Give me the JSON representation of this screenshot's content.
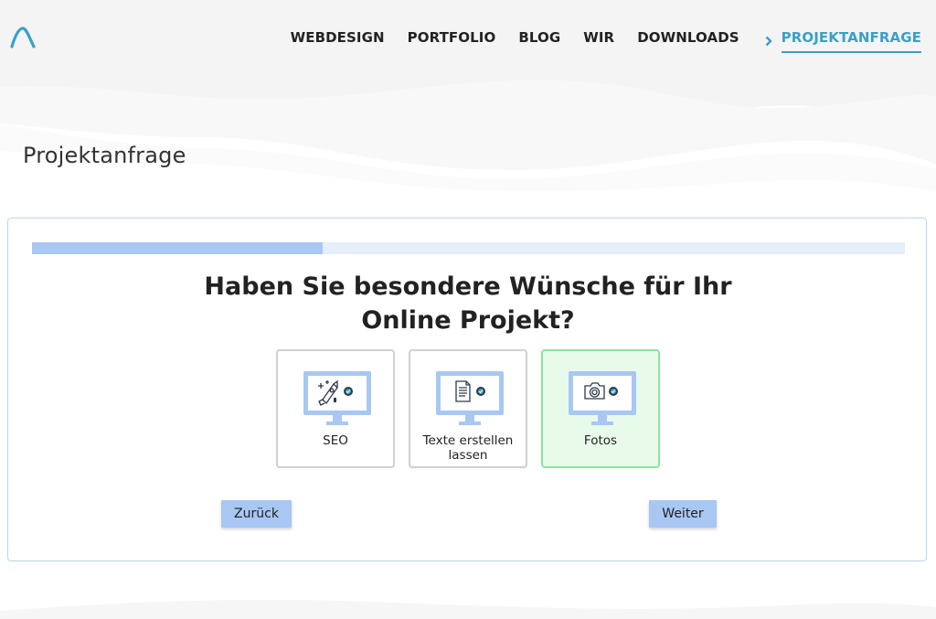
{
  "nav": {
    "items": [
      {
        "label": "WEBDESIGN"
      },
      {
        "label": "PORTFOLIO"
      },
      {
        "label": "BLOG"
      },
      {
        "label": "WIR"
      },
      {
        "label": "DOWNLOADS"
      }
    ],
    "active": {
      "label": "PROJEKTANFRAGE",
      "icon": "chevron-right-icon"
    }
  },
  "page": {
    "title": "Projektanfrage"
  },
  "wizard": {
    "progress": 0.333,
    "question_line1": "Haben Sie besondere Wünsche für Ihr",
    "question_line2": "Online Projekt?",
    "options": [
      {
        "label": "SEO",
        "icon": "seo-rocket-icon",
        "selected": false
      },
      {
        "label": "Texte erstellen lassen",
        "icon": "document-icon",
        "selected": false
      },
      {
        "label": "Fotos",
        "icon": "camera-icon",
        "selected": true
      }
    ],
    "back_label": "Zurück",
    "next_label": "Weiter"
  },
  "colors": {
    "accent": "#3c9fc6",
    "progress_fill": "#a8c7f2",
    "progress_track": "#e5eef9",
    "selected_bg": "#e8fbeb",
    "selected_border": "#8ee39e",
    "button_bg": "#a8c7f2"
  }
}
